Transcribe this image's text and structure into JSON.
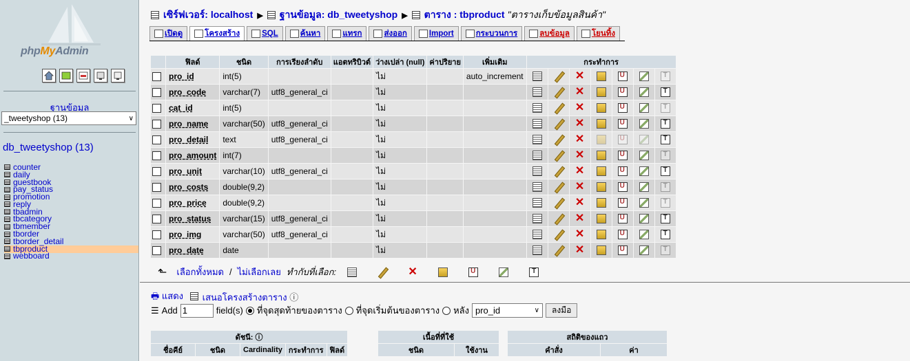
{
  "left": {
    "logo_pre": "php",
    "logo_my": "My",
    "logo_post": "Admin",
    "db_heading": "ฐานข้อมูล",
    "db_select_value": "_tweetyshop (13)",
    "db_title": "db_tweetyshop (13)",
    "tables": [
      "counter",
      "daily",
      "guestbook",
      "pay_status",
      "promotion",
      "reply",
      "tbadmin",
      "tbcategory",
      "tbmember",
      "tborder",
      "tborder_detail",
      "tbproduct",
      "webboard"
    ],
    "selected_table": "tbproduct"
  },
  "breadcrumb": {
    "server_label": "เซิร์ฟเวอร์: localhost",
    "db_label": "ฐานข้อมูล: db_tweetyshop",
    "table_label": "ตาราง : tbproduct",
    "table_comment": "\"ตารางเก็บข้อมูลสินค้า\""
  },
  "tabs": [
    {
      "label": "เปิดดู",
      "active": false,
      "danger": false
    },
    {
      "label": "โครงสร้าง",
      "active": true,
      "danger": false
    },
    {
      "label": "SQL",
      "active": false,
      "danger": false
    },
    {
      "label": "ค้นหา",
      "active": false,
      "danger": false
    },
    {
      "label": "แทรก",
      "active": false,
      "danger": false
    },
    {
      "label": "ส่งออก",
      "active": false,
      "danger": false
    },
    {
      "label": "Import",
      "active": false,
      "danger": false
    },
    {
      "label": "กระบวนการ",
      "active": false,
      "danger": false
    },
    {
      "label": "ลบข้อมูล",
      "active": false,
      "danger": true
    },
    {
      "label": "โยนทิ้ง",
      "active": false,
      "danger": true
    }
  ],
  "structure": {
    "headers": [
      "ฟิลด์",
      "ชนิด",
      "การเรียงลำดับ",
      "แอตทริบิวต์",
      "ว่างเปล่า (null)",
      "ค่าปริยาย",
      "เพิ่มเติม",
      "กระทำการ"
    ],
    "rows": [
      {
        "field": "pro_id",
        "type": "int(5)",
        "collation": "",
        "attributes": "",
        "null": "ไม่",
        "default": "",
        "extra": "auto_increment",
        "fulltext": false,
        "dim_index": false
      },
      {
        "field": "pro_code",
        "type": "varchar(7)",
        "collation": "utf8_general_ci",
        "attributes": "",
        "null": "ไม่",
        "default": "",
        "extra": "",
        "fulltext": true,
        "dim_index": false
      },
      {
        "field": "cat_id",
        "type": "int(5)",
        "collation": "",
        "attributes": "",
        "null": "ไม่",
        "default": "",
        "extra": "",
        "fulltext": false,
        "dim_index": false
      },
      {
        "field": "pro_name",
        "type": "varchar(50)",
        "collation": "utf8_general_ci",
        "attributes": "",
        "null": "ไม่",
        "default": "",
        "extra": "",
        "fulltext": true,
        "dim_index": false
      },
      {
        "field": "pro_detail",
        "type": "text",
        "collation": "utf8_general_ci",
        "attributes": "",
        "null": "ไม่",
        "default": "",
        "extra": "",
        "fulltext": true,
        "dim_index": true
      },
      {
        "field": "pro_amount",
        "type": "int(7)",
        "collation": "",
        "attributes": "",
        "null": "ไม่",
        "default": "",
        "extra": "",
        "fulltext": false,
        "dim_index": false
      },
      {
        "field": "pro_unit",
        "type": "varchar(10)",
        "collation": "utf8_general_ci",
        "attributes": "",
        "null": "ไม่",
        "default": "",
        "extra": "",
        "fulltext": true,
        "dim_index": false
      },
      {
        "field": "pro_costs",
        "type": "double(9,2)",
        "collation": "",
        "attributes": "",
        "null": "ไม่",
        "default": "",
        "extra": "",
        "fulltext": false,
        "dim_index": false
      },
      {
        "field": "pro_price",
        "type": "double(9,2)",
        "collation": "",
        "attributes": "",
        "null": "ไม่",
        "default": "",
        "extra": "",
        "fulltext": false,
        "dim_index": false
      },
      {
        "field": "pro_status",
        "type": "varchar(15)",
        "collation": "utf8_general_ci",
        "attributes": "",
        "null": "ไม่",
        "default": "",
        "extra": "",
        "fulltext": true,
        "dim_index": false
      },
      {
        "field": "pro_img",
        "type": "varchar(50)",
        "collation": "utf8_general_ci",
        "attributes": "",
        "null": "ไม่",
        "default": "",
        "extra": "",
        "fulltext": true,
        "dim_index": false
      },
      {
        "field": "pro_date",
        "type": "date",
        "collation": "",
        "attributes": "",
        "null": "ไม่",
        "default": "",
        "extra": "",
        "fulltext": false,
        "dim_index": false
      }
    ]
  },
  "bulk": {
    "check_all": "เลือกทั้งหมด",
    "separator": " / ",
    "uncheck_all": "ไม่เลือกเลย",
    "with_selected": "ทำกับที่เลือก:"
  },
  "links": {
    "print_view": "แสดง",
    "propose": "เสนอโครงสร้างตาราง"
  },
  "add_field": {
    "add_label": "Add",
    "count": "1",
    "fields_label": "field(s)",
    "opt_end": "ที่จุดสุดท้ายของตาราง",
    "opt_begin": "ที่จุดเริ่มต้นของตาราง",
    "opt_after": "หลัง",
    "after_value": "pro_id",
    "go": "ลงมือ"
  },
  "bottom": {
    "index_title": "ดัชนี:",
    "index_headers": [
      "ชื่อคีย์",
      "ชนิด",
      "Cardinality",
      "กระทำการ",
      "ฟิลด์"
    ],
    "space_title": "เนื้อที่ที่ใช้",
    "space_headers": [
      "ชนิด",
      "ใช้งาน"
    ],
    "stats_title": "สถิติของแถว",
    "stats_headers": [
      "คำสั่ง",
      "ค่า"
    ]
  }
}
